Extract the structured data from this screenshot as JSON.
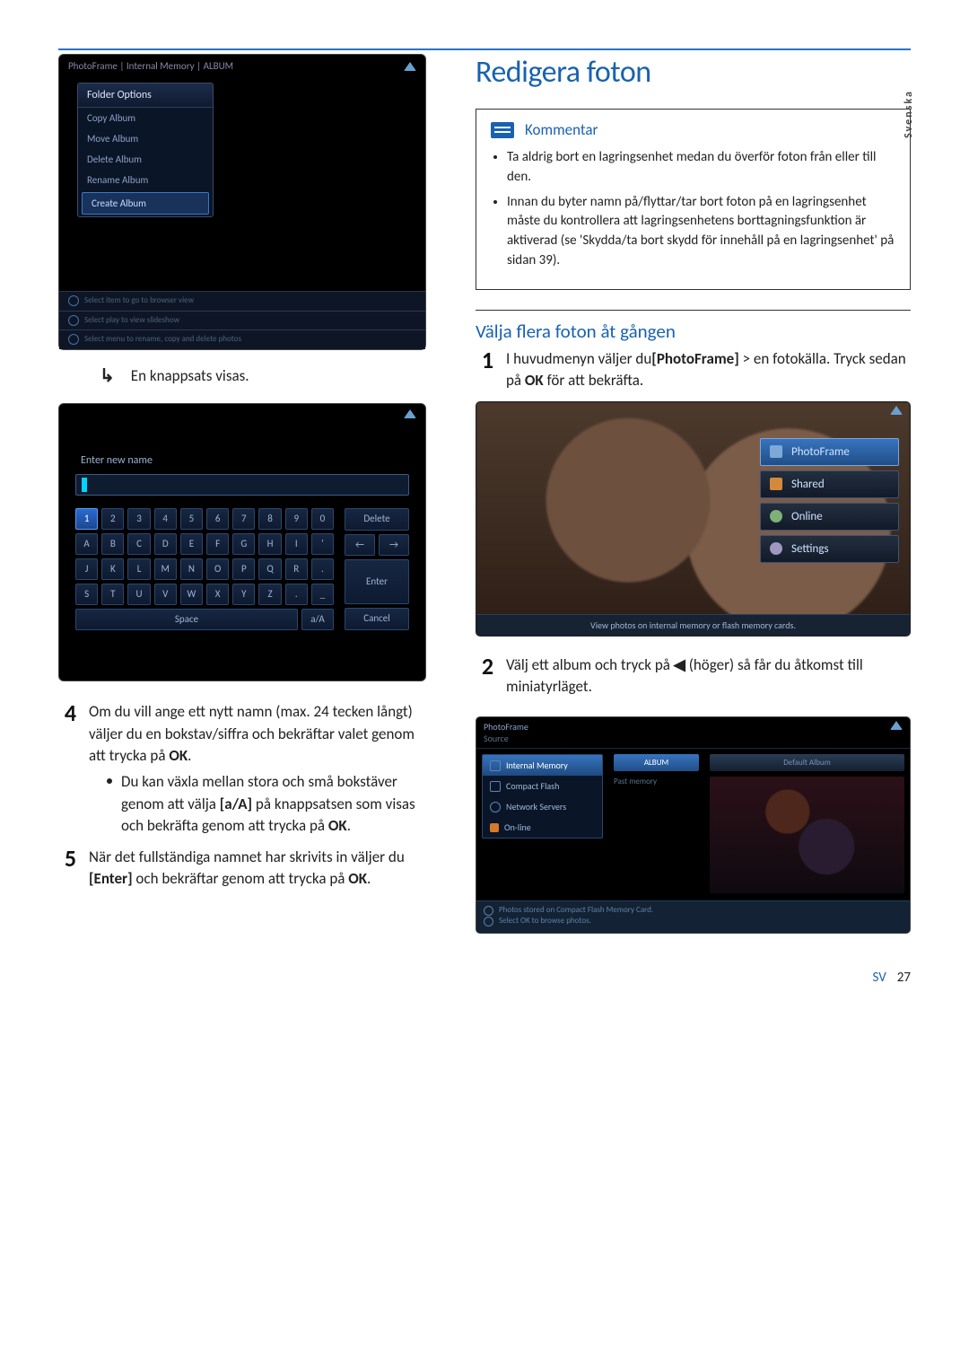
{
  "lang_tab": "Svenska",
  "left": {
    "folder_breadcrumb": "PhotoFrame | Internal Memory | ALBUM",
    "folder_menu_title": "Folder Options",
    "folder_items": {
      "a": "Copy Album",
      "b": "Move Album",
      "c": "Delete Album",
      "d": "Rename Album",
      "e": "Create Album"
    },
    "arrow_text": "En knappsats visas.",
    "keyboard": {
      "prompt": "Enter new name",
      "rows": {
        "r0": {
          "a": "1",
          "b": "2",
          "c": "3",
          "d": "4",
          "e": "5",
          "f": "6",
          "g": "7",
          "h": "8",
          "i": "9",
          "j": "0"
        },
        "r1": {
          "a": "A",
          "b": "B",
          "c": "C",
          "d": "D",
          "e": "E",
          "f": "F",
          "g": "G",
          "h": "H",
          "i": "I",
          "j": "'"
        },
        "r2": {
          "a": "J",
          "b": "K",
          "c": "L",
          "d": "M",
          "e": "N",
          "f": "O",
          "g": "P",
          "h": "Q",
          "i": "R",
          "j": "."
        },
        "r3": {
          "a": "S",
          "b": "T",
          "c": "U",
          "d": "V",
          "e": "W",
          "f": "X",
          "g": "Y",
          "h": "Z",
          "i": ".",
          "j": "_"
        }
      },
      "right": {
        "delete": "Delete",
        "left": "←",
        "right_arr": "→",
        "enter": "Enter",
        "cancel": "Cancel"
      },
      "space": "Space",
      "aA": "a/A"
    },
    "step4_num": "4",
    "step4_text_a": "Om du vill ange ett nytt namn (max. 24 tecken långt) väljer du en bokstav/siffra och bekräftar valet genom att trycka på ",
    "step4_ok": "OK",
    "step4_bul_a": "Du kan växla mellan stora och små bokstäver genom att välja ",
    "step4_aA": "[a/A]",
    "step4_bul_b": " på knappsatsen som visas och bekräfta genom att trycka på ",
    "step5_num": "5",
    "step5_a": "När det fullständiga namnet har skrivits in väljer du ",
    "step5_enter": "[Enter]",
    "step5_b": " och bekräftar genom att trycka på ",
    "step5_ok": "OK"
  },
  "right": {
    "title": "Redigera foton",
    "note_label": "Kommentar",
    "note_items": {
      "a": "Ta aldrig bort en lagringsenhet medan du överför foton från eller till den.",
      "b": "Innan du byter namn på/flyttar/tar bort foton på en lagringsenhet måste du kontrollera att lagringsenhetens borttagningsfunktion är aktiverad (se 'Skydda/ta bort skydd för innehåll på en lagringsenhet' på sidan 39)."
    },
    "subheading": "Välja flera foton åt gången",
    "step1_num": "1",
    "step1_a": "I huvudmenyn väljer du",
    "step1_pf": "[PhotoFrame]",
    "step1_b": " > en fotokälla. Tryck sedan på ",
    "step1_ok": "OK",
    "step1_c": " för att bekräfta.",
    "pf_screen": {
      "btn1": "PhotoFrame",
      "btn2": "Shared",
      "btn3": "Online",
      "btn4": "Settings",
      "footer": "View photos on internal memory or flash memory cards."
    },
    "step2_num": "2",
    "step2_a": "Välj ett album och tryck på ",
    "step2_b": " (höger) så får du åtkomst till miniatyrläget.",
    "src_screen": {
      "title": "PhotoFrame",
      "sub": "Source",
      "menu": {
        "a": "Internal Memory",
        "b": "Compact Flash",
        "c": "Network Servers",
        "d": "On-line"
      },
      "col2": "ALBUM",
      "col2_sub": "Past memory",
      "col3": "Default Album",
      "footer1": "Photos stored on Compact Flash Memory Card.",
      "footer2": "Select OK to browse photos."
    }
  },
  "page_label": "SV",
  "page_number": "27"
}
